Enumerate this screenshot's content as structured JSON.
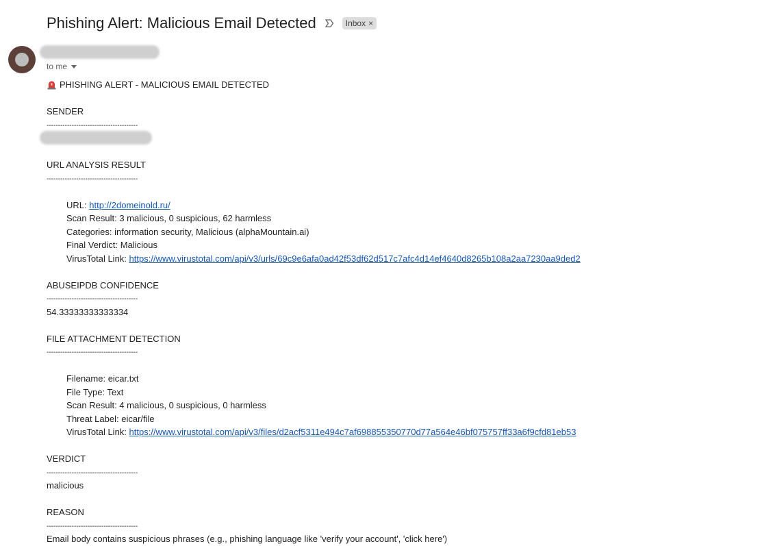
{
  "email": {
    "subject": "Phishing Alert: Malicious Email Detected",
    "label": "Inbox",
    "label_close": "×",
    "to_me": "to me"
  },
  "body": {
    "alert_heading": "PHISHING ALERT - MALICIOUS EMAIL DETECTED",
    "divider": "----------------------------------------",
    "sender": {
      "heading": "SENDER"
    },
    "url_analysis": {
      "heading": "URL ANALYSIS RESULT",
      "url_label": "URL: ",
      "url": "http://2domeinold.ru/",
      "scan_result": "Scan Result: 3 malicious, 0 suspicious, 62 harmless",
      "categories": "Categories: information security, Malicious (alphaMountain.ai)",
      "final_verdict": "Final Verdict: Malicious",
      "vt_label": "VirusTotal Link: ",
      "vt_link": "https://www.virustotal.com/api/v3/urls/69c9e6afa0ad42f53df62d517c7afc4d14ef4640d8265b108a2aa7230aa9ded2"
    },
    "abuseipdb": {
      "heading": "ABUSEIPDB CONFIDENCE",
      "value": "54.33333333333334"
    },
    "file_attachment": {
      "heading": "FILE ATTACHMENT DETECTION",
      "filename": "Filename: eicar.txt",
      "file_type": "File Type: Text",
      "scan_result": "Scan Result: 4 malicious, 0 suspicious, 0 harmless",
      "threat_label": "Threat Label: eicar/file",
      "vt_label": "VirusTotal Link: ",
      "vt_link": "https://www.virustotal.com/api/v3/files/d2acf5311e494c7af698855350770d77a564e46bf075757ff33a6f9cfd81eb53"
    },
    "verdict": {
      "heading": "VERDICT",
      "value": "malicious"
    },
    "reason": {
      "heading": "REASON",
      "value": "Email body contains suspicious phrases (e.g., phishing language like 'verify your account', 'click here')"
    }
  },
  "colors": {
    "link": "#1155cc",
    "label_chip": "#dddddd",
    "avatar": "#5d4037",
    "alarm": "#e53935"
  },
  "icons": {
    "important": "important-marker-icon",
    "alarm": "police-light-icon",
    "caret": "caret-down-icon"
  }
}
